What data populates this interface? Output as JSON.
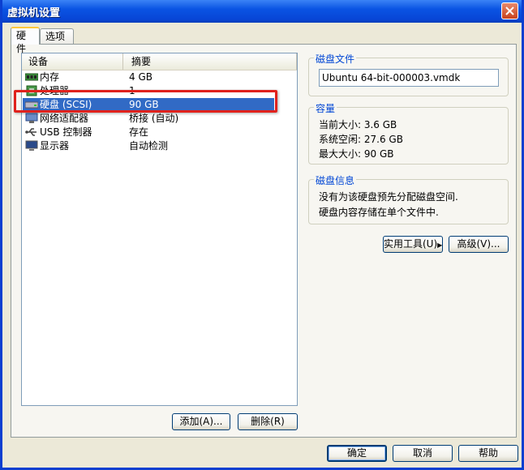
{
  "window": {
    "title": "虚拟机设置"
  },
  "tabs": [
    {
      "label": "硬件",
      "active": true
    },
    {
      "label": "选项",
      "active": false
    }
  ],
  "device_list": {
    "columns": [
      "设备",
      "摘要"
    ],
    "rows": [
      {
        "icon": "memory-icon",
        "name": "内存",
        "summary": "4 GB",
        "selected": false
      },
      {
        "icon": "processor-icon",
        "name": "处理器",
        "summary": "1",
        "selected": false
      },
      {
        "icon": "hard-disk-icon",
        "name": "硬盘 (SCSI)",
        "summary": "90 GB",
        "selected": true
      },
      {
        "icon": "network-adapter-icon",
        "name": "网络适配器",
        "summary": "桥接 (自动)",
        "selected": false
      },
      {
        "icon": "usb-icon",
        "name": "USB 控制器",
        "summary": "存在",
        "selected": false
      },
      {
        "icon": "display-icon",
        "name": "显示器",
        "summary": "自动检测",
        "selected": false
      }
    ],
    "add_button": "添加(A)...",
    "remove_button": "删除(R)"
  },
  "disk_file": {
    "legend": "磁盘文件",
    "value": "Ubuntu 64-bit-000003.vmdk"
  },
  "capacity": {
    "legend": "容量",
    "current_size": "当前大小: 3.6 GB",
    "system_free": "系统空闲: 27.6 GB",
    "max_size": "最大大小: 90 GB"
  },
  "disk_info": {
    "legend": "磁盘信息",
    "line1": "没有为该硬盘预先分配磁盘空间.",
    "line2": "硬盘内容存储在单个文件中."
  },
  "actions": {
    "utilities_button": "实用工具(U)",
    "advanced_button": "高级(V)..."
  },
  "footer": {
    "ok": "确定",
    "cancel": "取消",
    "help": "帮助"
  },
  "colors": {
    "selection": "#316ac5",
    "highlight_border": "#e0221d",
    "legend_text": "#0046d5"
  }
}
